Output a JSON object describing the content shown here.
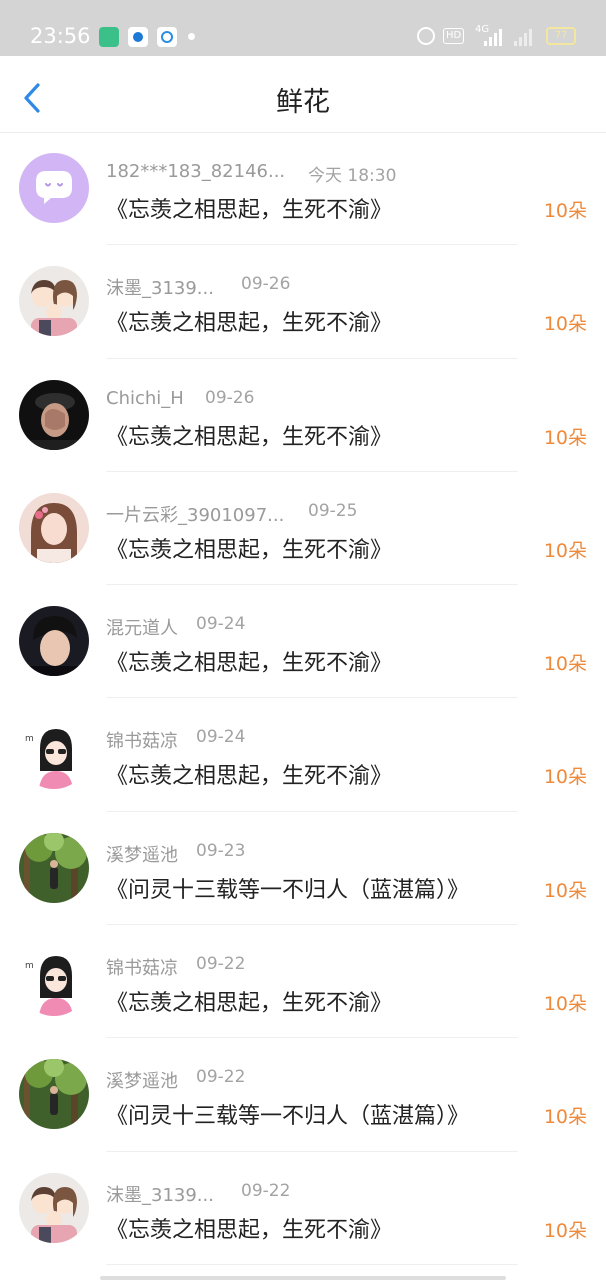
{
  "status_bar": {
    "time": "23:56",
    "network": "4G",
    "hd": "HD",
    "battery": "77"
  },
  "header": {
    "title": "鲜花",
    "back_icon": "chevron-left-icon"
  },
  "colors": {
    "accent_blue": "#2f8ae6",
    "flower_count": "#ee8a3c",
    "status_bar_bg": "#d4d4d4"
  },
  "list": [
    {
      "user": "182***183_82146...",
      "date": "今天 18:30",
      "book": "《忘羡之相思起，生死不渝》",
      "count": "10朵",
      "avatar": "chat-bubble-avatar"
    },
    {
      "user": "沫墨_3139...",
      "date": "09-26",
      "book": "《忘羡之相思起，生死不渝》",
      "count": "10朵",
      "avatar": "cartoon-family-avatar"
    },
    {
      "user": "Chichi_H",
      "date": "09-26",
      "book": "《忘羡之相思起，生死不渝》",
      "count": "10朵",
      "avatar": "dark-portrait-avatar"
    },
    {
      "user": "一片云彩_3901097...",
      "date": "09-25",
      "book": "《忘羡之相思起，生死不渝》",
      "count": "10朵",
      "avatar": "woman-portrait-avatar"
    },
    {
      "user": "混元道人",
      "date": "09-24",
      "book": "《忘羡之相思起，生死不渝》",
      "count": "10朵",
      "avatar": "man-portrait-avatar"
    },
    {
      "user": "锦书菇凉",
      "date": "09-24",
      "book": "《忘羡之相思起，生死不渝》",
      "count": "10朵",
      "avatar": "cartoon-girl-avatar"
    },
    {
      "user": "溪梦遥池",
      "date": "09-23",
      "book": "《问灵十三载等一不归人（蓝湛篇）》",
      "count": "10朵",
      "avatar": "forest-photo-avatar"
    },
    {
      "user": "锦书菇凉",
      "date": "09-22",
      "book": "《忘羡之相思起，生死不渝》",
      "count": "10朵",
      "avatar": "cartoon-girl-avatar"
    },
    {
      "user": "溪梦遥池",
      "date": "09-22",
      "book": "《问灵十三载等一不归人（蓝湛篇）》",
      "count": "10朵",
      "avatar": "forest-photo-avatar"
    },
    {
      "user": "沫墨_3139...",
      "date": "09-22",
      "book": "《忘羡之相思起，生死不渝》",
      "count": "10朵",
      "avatar": "cartoon-family-avatar"
    }
  ]
}
